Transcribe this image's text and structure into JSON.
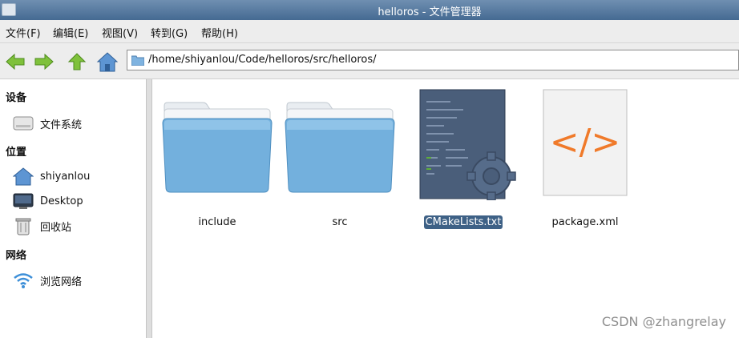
{
  "window": {
    "title": "helloros - 文件管理器"
  },
  "menubar": [
    "文件(F)",
    "编辑(E)",
    "视图(V)",
    "转到(G)",
    "帮助(H)"
  ],
  "toolbar": {
    "path": "/home/shiyanlou/Code/helloros/src/helloros/"
  },
  "sidebar": {
    "sections": [
      {
        "title": "设备",
        "items": [
          {
            "label": "文件系统",
            "icon": "drive-icon"
          }
        ]
      },
      {
        "title": "位置",
        "items": [
          {
            "label": "shiyanlou",
            "icon": "home-icon"
          },
          {
            "label": "Desktop",
            "icon": "desktop-icon"
          },
          {
            "label": "回收站",
            "icon": "trash-icon"
          }
        ]
      },
      {
        "title": "网络",
        "items": [
          {
            "label": "浏览网络",
            "icon": "wifi-icon"
          }
        ]
      }
    ]
  },
  "files": [
    {
      "name": "include",
      "icon": "folder-icon",
      "selected": false
    },
    {
      "name": "src",
      "icon": "folder-icon",
      "selected": false
    },
    {
      "name": "CMakeLists.txt",
      "icon": "script-gear-icon",
      "selected": true
    },
    {
      "name": "package.xml",
      "icon": "xml-file-icon",
      "selected": false
    }
  ],
  "watermark": "CSDN @zhangrelay",
  "colors": {
    "titlebar": "#4f739b",
    "selection": "#3e6186",
    "xml_accent": "#f07a2a",
    "folder": "#73b0dd"
  }
}
